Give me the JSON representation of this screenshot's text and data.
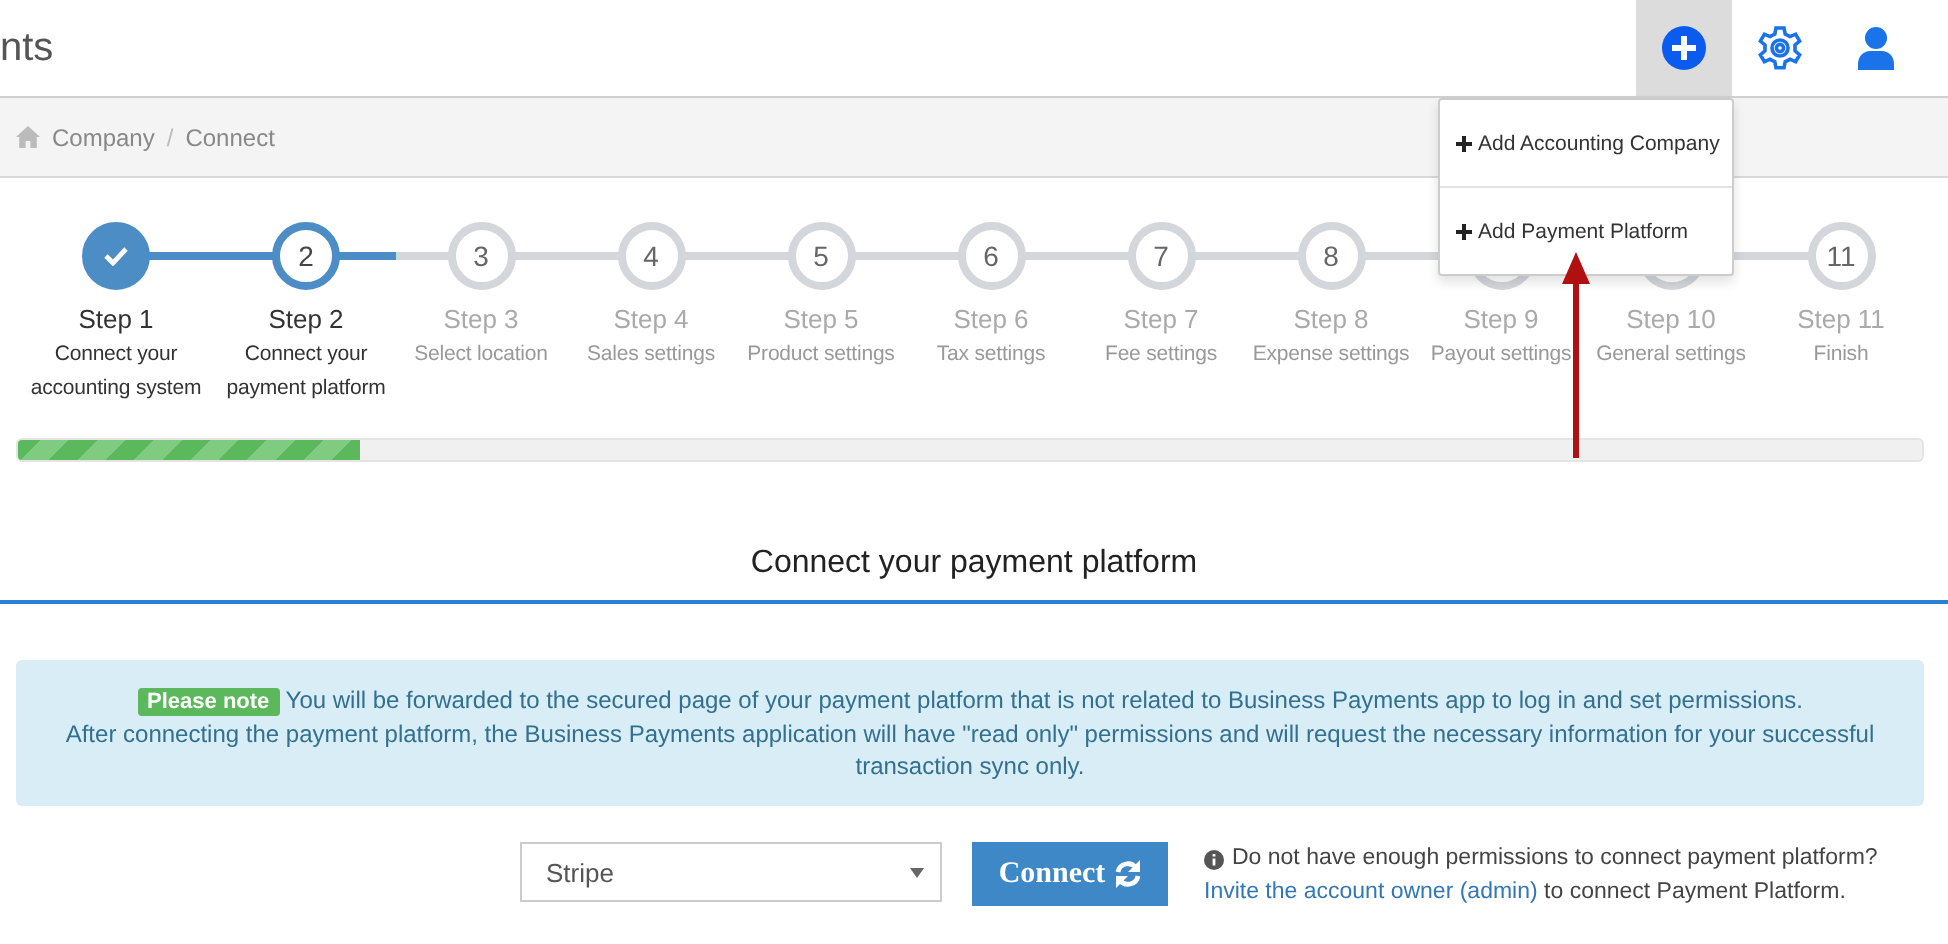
{
  "header": {
    "title": "nts"
  },
  "toolbar": [
    {
      "kind": "add",
      "selected": true
    },
    {
      "kind": "settings",
      "selected": false
    },
    {
      "kind": "user",
      "selected": false
    }
  ],
  "breadcrumb": {
    "separator": "/",
    "items": [
      {
        "label": "Company",
        "kind": "home"
      },
      {
        "label": "Connect",
        "kind": "plain"
      }
    ]
  },
  "add_menu": {
    "items": [
      {
        "label": "Add Accounting Company"
      },
      {
        "label": "Add Payment Platform"
      }
    ]
  },
  "steps": [
    {
      "done": true,
      "selected": false,
      "title": "Step 1",
      "description": "Connect your accounting system"
    },
    {
      "number": "2",
      "done": false,
      "selected": true,
      "title": "Step 2",
      "description": "Connect your payment platform"
    },
    {
      "number": "3",
      "done": false,
      "selected": false,
      "title": "Step 3",
      "description": "Select location"
    },
    {
      "number": "4",
      "done": false,
      "selected": false,
      "title": "Step 4",
      "description": "Sales settings"
    },
    {
      "number": "5",
      "done": false,
      "selected": false,
      "title": "Step 5",
      "description": "Product settings"
    },
    {
      "number": "6",
      "done": false,
      "selected": false,
      "title": "Step 6",
      "description": "Tax settings"
    },
    {
      "number": "7",
      "done": false,
      "selected": false,
      "title": "Step 7",
      "description": "Fee settings"
    },
    {
      "number": "8",
      "done": false,
      "selected": false,
      "title": "Step 8",
      "description": "Expense settings"
    },
    {
      "done": false,
      "selected": false,
      "title": "Step 9",
      "description": "Payout settings"
    },
    {
      "done": false,
      "selected": false,
      "title": "Step 10",
      "description": "General settings"
    },
    {
      "number": "11",
      "done": false,
      "selected": false,
      "title": "Step 11",
      "description": "Finish"
    }
  ],
  "progress": {
    "level": 0.18
  },
  "section_title": "Connect your payment platform",
  "alert": {
    "badge": "Please note",
    "line_1": "You will be forwarded to the secured page of your payment platform that is not related to Business Payments app to log in and set permissions.",
    "line_2": "After connecting the payment platform, the Business Payments application will have \"read only\" permissions and will request the necessary information for your successful transaction sync only."
  },
  "platform_select": {
    "value": "Stripe"
  },
  "connect_button": {
    "label": "Connect"
  },
  "help": {
    "question": "Do not have enough permissions to connect payment platform?",
    "link": "Invite the account owner (admin)",
    "rest": "to connect Payment Platform."
  }
}
